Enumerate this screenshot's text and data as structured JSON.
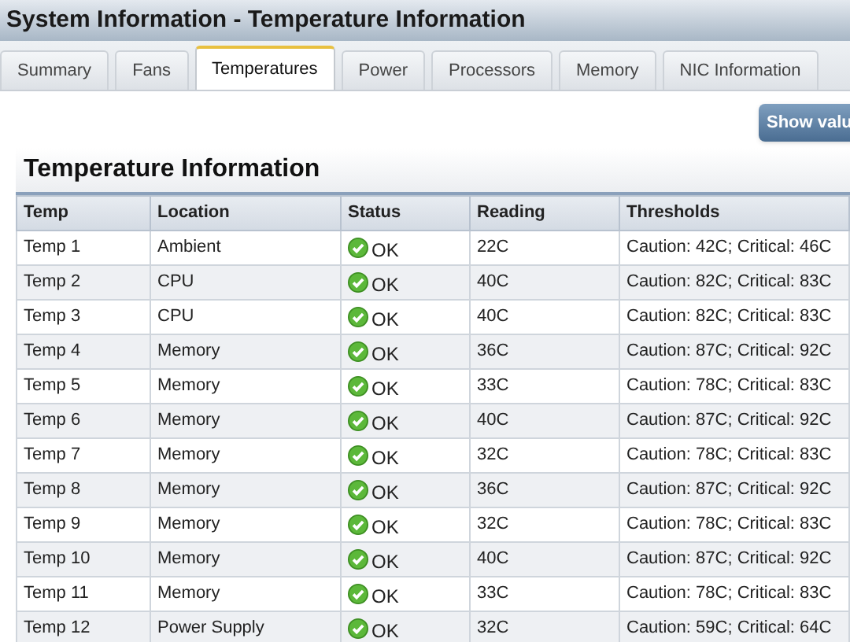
{
  "window": {
    "title": "System Information - Temperature Information"
  },
  "tabs": [
    {
      "label": "Summary",
      "selected": false
    },
    {
      "label": "Fans",
      "selected": false
    },
    {
      "label": "Temperatures",
      "selected": true
    },
    {
      "label": "Power",
      "selected": false
    },
    {
      "label": "Processors",
      "selected": false
    },
    {
      "label": "Memory",
      "selected": false
    },
    {
      "label": "NIC Information",
      "selected": false
    }
  ],
  "show_button": {
    "label": "Show valu"
  },
  "section": {
    "title": "Temperature Information"
  },
  "table": {
    "columns": [
      "Temp",
      "Location",
      "Status",
      "Reading",
      "Thresholds"
    ],
    "rows": [
      {
        "temp": "Temp 1",
        "location": "Ambient",
        "kind": "ok",
        "status_text": "OK",
        "reading": "22C",
        "thresholds": "Caution: 42C; Critical: 46C"
      },
      {
        "temp": "Temp 2",
        "location": "CPU",
        "kind": "ok",
        "status_text": "OK",
        "reading": "40C",
        "thresholds": "Caution: 82C; Critical: 83C"
      },
      {
        "temp": "Temp 3",
        "location": "CPU",
        "kind": "ok",
        "status_text": "OK",
        "reading": "40C",
        "thresholds": "Caution: 82C; Critical: 83C"
      },
      {
        "temp": "Temp 4",
        "location": "Memory",
        "kind": "ok",
        "status_text": "OK",
        "reading": "36C",
        "thresholds": "Caution: 87C; Critical: 92C"
      },
      {
        "temp": "Temp 5",
        "location": "Memory",
        "kind": "ok",
        "status_text": "OK",
        "reading": "33C",
        "thresholds": "Caution: 78C; Critical: 83C"
      },
      {
        "temp": "Temp 6",
        "location": "Memory",
        "kind": "ok",
        "status_text": "OK",
        "reading": "40C",
        "thresholds": "Caution: 87C; Critical: 92C"
      },
      {
        "temp": "Temp 7",
        "location": "Memory",
        "kind": "ok",
        "status_text": "OK",
        "reading": "32C",
        "thresholds": "Caution: 78C; Critical: 83C"
      },
      {
        "temp": "Temp 8",
        "location": "Memory",
        "kind": "ok",
        "status_text": "OK",
        "reading": "36C",
        "thresholds": "Caution: 87C; Critical: 92C"
      },
      {
        "temp": "Temp 9",
        "location": "Memory",
        "kind": "ok",
        "status_text": "OK",
        "reading": "32C",
        "thresholds": "Caution: 78C; Critical: 83C"
      },
      {
        "temp": "Temp 10",
        "location": "Memory",
        "kind": "ok",
        "status_text": "OK",
        "reading": "40C",
        "thresholds": "Caution: 87C; Critical: 92C"
      },
      {
        "temp": "Temp 11",
        "location": "Memory",
        "kind": "ok",
        "status_text": "OK",
        "reading": "33C",
        "thresholds": "Caution: 78C; Critical: 83C"
      },
      {
        "temp": "Temp 12",
        "location": "Power Supply",
        "kind": "ok",
        "status_text": "OK",
        "reading": "32C",
        "thresholds": "Caution: 59C; Critical: 64C"
      }
    ]
  }
}
